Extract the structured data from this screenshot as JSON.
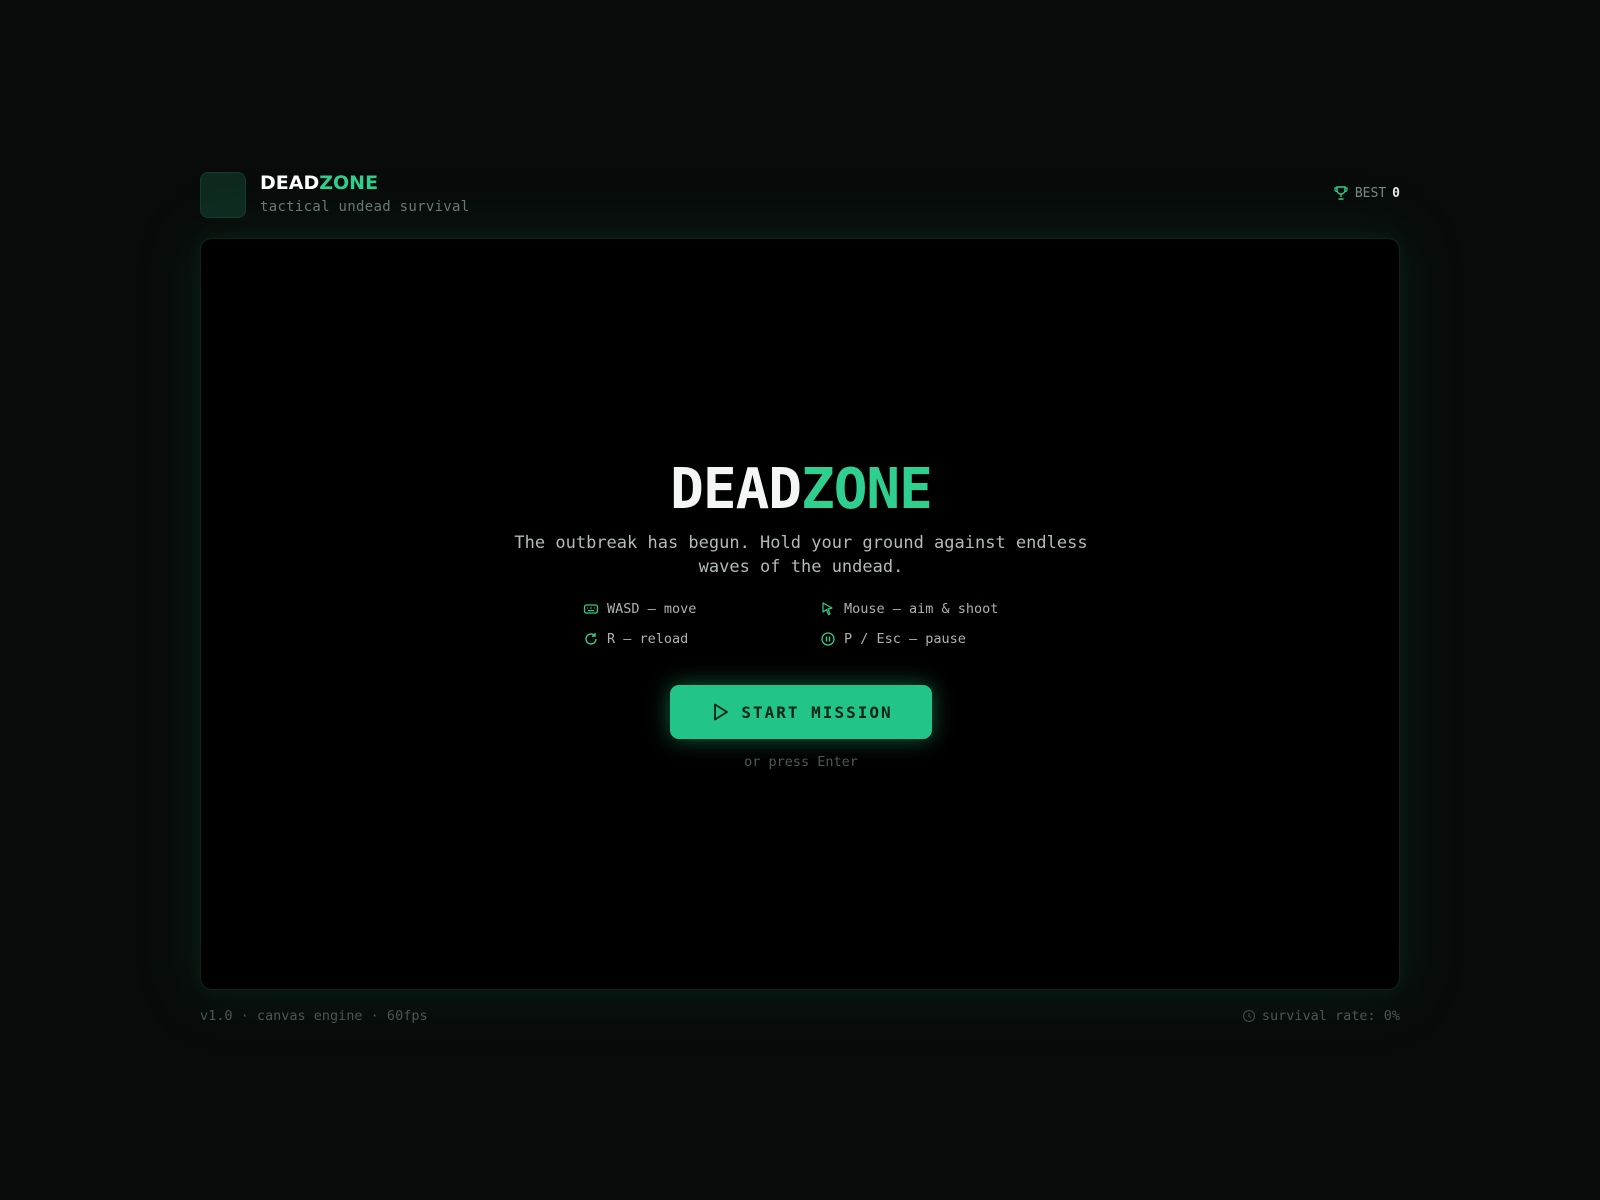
{
  "header": {
    "brand_dead": "DEAD",
    "brand_zone": "ZONE",
    "tagline": "tactical undead survival",
    "best_label": "BEST",
    "best_value": "0"
  },
  "menu": {
    "title_dead": "DEAD",
    "title_zone": "ZONE",
    "description": "The outbreak has begun. Hold your ground against endless waves of the undead.",
    "controls": [
      {
        "icon": "keyboard-icon",
        "text": "WASD — move"
      },
      {
        "icon": "mouse-pointer-icon",
        "text": "Mouse — aim & shoot"
      },
      {
        "icon": "reload-icon",
        "text": "R — reload"
      },
      {
        "icon": "pause-icon",
        "text": "P / Esc — pause"
      }
    ],
    "start_label": "START MISSION",
    "hint": "or press Enter"
  },
  "footer": {
    "info": "v1.0 · canvas engine · 60fps",
    "survival": "survival rate: 0%"
  },
  "colors": {
    "accent": "#2fcf8f",
    "button": "#22c487",
    "background": "#080b0a",
    "canvas": "#000000"
  }
}
